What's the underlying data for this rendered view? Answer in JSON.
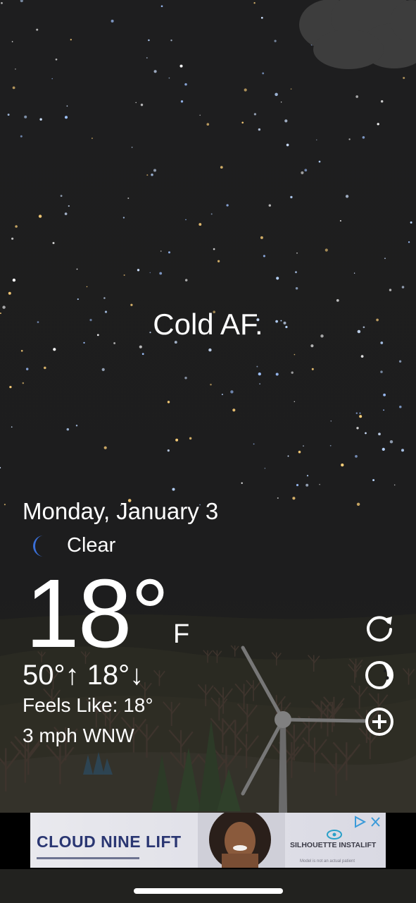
{
  "weather": {
    "tagline": "Cold AF.",
    "date": "Monday, January 3",
    "condition": "Clear",
    "condition_icon": "moon-icon",
    "temperature": "18°",
    "unit": "F",
    "high_low": "50°↑ 18°↓",
    "feels_like": "Feels Like: 18°",
    "wind": "3 mph WNW"
  },
  "controls": [
    "refresh-icon",
    "moon-phase-icon",
    "add-icon"
  ],
  "ad": {
    "brand": "CLOUD NINE LIFT",
    "product": "SILHOUETTE INSTALIFT",
    "disclaimer": "Model is not an actual patient",
    "choices_icons": [
      "ad-choices-icon",
      "close-icon"
    ]
  },
  "colors": {
    "sky": "#1e1e1f",
    "text": "#ffffff",
    "moon_icon": "#3a6fd8",
    "ad_brand": "#2a3672"
  }
}
